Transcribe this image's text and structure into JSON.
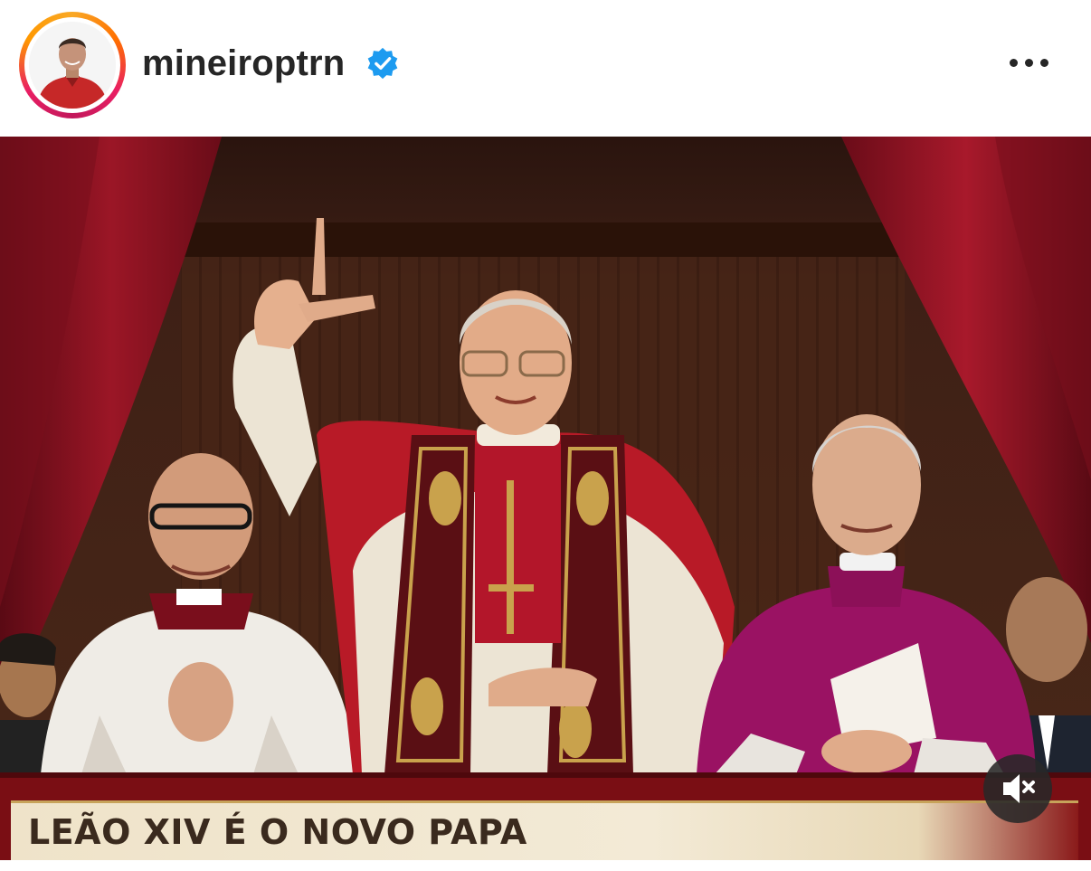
{
  "post": {
    "username": "mineiroptrn",
    "verified": true,
    "more_icon": "more-horizontal-icon",
    "image": {
      "banner_text": "LEÃO XIV É O NOVO PAPA",
      "mute_icon": "speaker-muted-icon"
    }
  },
  "colors": {
    "verified_blue": "#1d9bf0",
    "text_dark": "#262626",
    "curtain_red": "#8b1220",
    "banner_cream": "#efe3c9"
  }
}
